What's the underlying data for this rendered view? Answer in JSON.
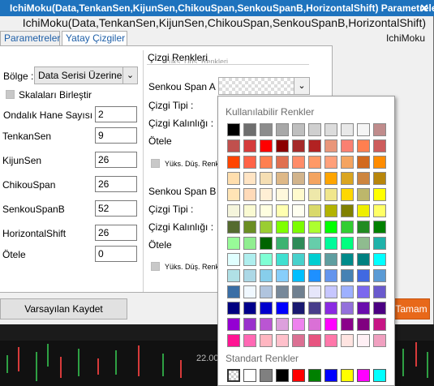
{
  "window": {
    "title": "IchiMoku(Data,TenkanSen,KijunSen,ChikouSpan,SenkouSpanB,HorizontalShift) Parametreleri",
    "subtitle": "IchiMoku(Data,TenkanSen,KijunSen,ChikouSpan,SenkouSpanB,HorizontalShift)",
    "chart_name": "IchiMoku",
    "close_glyph": "✕"
  },
  "tabs": [
    {
      "label": "Parametreler",
      "active": false
    },
    {
      "label": "Yatay Çizgiler",
      "active": true
    }
  ],
  "params": {
    "region_label": "Bölge :",
    "region_value": "Data Serisi Üzerine",
    "merge_scales_label": "Skalaları Birleştir",
    "decimal_label": "Ondalık Hane Sayısı :",
    "decimal_value": "2",
    "fields": [
      {
        "label": "TenkanSen",
        "value": "9"
      },
      {
        "label": "KijunSen",
        "value": "26"
      },
      {
        "label": "ChikouSpan",
        "value": "26"
      },
      {
        "label": "SenkouSpanB",
        "value": "52"
      },
      {
        "label": "HorizontalShift",
        "value": "26"
      },
      {
        "label": "Ötele",
        "value": "0"
      }
    ]
  },
  "line_colors": {
    "header": "Çizgi Renkleri",
    "hidden_label": "Yüks. Düş. Renkleri",
    "section_a": {
      "title": "Senkou Span A",
      "line_type": "Çizgi Tipi :",
      "line_width": "Çizgi Kalınlığı :",
      "shift": "Ötele",
      "hl_colors": "Yüks. Düş. Renkleri"
    },
    "section_b": {
      "title": "Senkou Span B",
      "line_type": "Çizgi Tipi :",
      "line_width": "Çizgi Kalınlığı :",
      "shift": "Ötele",
      "hl_colors": "Yüks. Düş. Renkleri"
    }
  },
  "buttons": {
    "save_default": "Varsayılan Kaydet",
    "ok": "Tamam"
  },
  "color_picker": {
    "available_title": "Kullanılabilir Renkler",
    "standard_title": "Standart Renkler",
    "available": [
      [
        "#000000",
        "#6e6e6e",
        "#8c8c8c",
        "#a8a8a8",
        "#bfbfbf",
        "#cfcfcf",
        "#dcdcdc",
        "#e8e8e8",
        "#f5f5f5",
        "#c08c8c"
      ],
      [
        "#c0504d",
        "#d43c3c",
        "#ff0000",
        "#8b0000",
        "#a52a2a",
        "#b22222",
        "#e9967a",
        "#fa8072",
        "#ff7f50",
        "#cd5c5c"
      ],
      [
        "#ff4500",
        "#ff6347",
        "#ff7f50",
        "#e07050",
        "#ff8c69",
        "#ff9966",
        "#ffa07a",
        "#f4a460",
        "#d2691e",
        "#ff8c00"
      ],
      [
        "#ffdead",
        "#ffe4c4",
        "#f5deb3",
        "#deb887",
        "#d2b48c",
        "#f4a460",
        "#ffa500",
        "#daa520",
        "#cd853f",
        "#b8860b"
      ],
      [
        "#ffe4b5",
        "#ffdab9",
        "#ffefd5",
        "#fff8dc",
        "#fffacd",
        "#eee8aa",
        "#f0e68c",
        "#ffd700",
        "#bdb76b",
        "#ffff00"
      ],
      [
        "#f5f5dc",
        "#fafad2",
        "#ffffe0",
        "#ffffb0",
        "#fffff0",
        "#d9d96a",
        "#b3b300",
        "#808000",
        "#eeee00",
        "#ffff66"
      ],
      [
        "#556b2f",
        "#6b8e23",
        "#9acd32",
        "#7fff00",
        "#7cfc00",
        "#adff2f",
        "#00ff00",
        "#32cd32",
        "#228b22",
        "#008000"
      ],
      [
        "#98fb98",
        "#90ee90",
        "#006400",
        "#3cb371",
        "#2e8b57",
        "#66cdaa",
        "#00fa9a",
        "#00ff7f",
        "#8fbc8f",
        "#20b2aa"
      ],
      [
        "#e0ffff",
        "#afeeee",
        "#7fffd4",
        "#40e0d0",
        "#48d1cc",
        "#00ced1",
        "#5f9ea0",
        "#008b8b",
        "#008080",
        "#00ffff"
      ],
      [
        "#b0e0e6",
        "#add8e6",
        "#87ceeb",
        "#87cefa",
        "#00bfff",
        "#1e90ff",
        "#6495ed",
        "#4682b4",
        "#4169e1",
        "#5b9bd5"
      ],
      [
        "#3a6ea5",
        "#f0f8ff",
        "#b0c4de",
        "#778899",
        "#708090",
        "#e6e6fa",
        "#c6c6ff",
        "#9db0ff",
        "#7b68ee",
        "#6a5acd"
      ],
      [
        "#000080",
        "#00008b",
        "#0000cd",
        "#0000ff",
        "#191970",
        "#483d8b",
        "#8a2be2",
        "#9370db",
        "#6a0dad",
        "#4b0082"
      ],
      [
        "#9400d3",
        "#9932cc",
        "#ba55d3",
        "#dda0dd",
        "#ee82ee",
        "#da70d6",
        "#ff00ff",
        "#8b008b",
        "#800080",
        "#c71585"
      ],
      [
        "#ff1493",
        "#ff69b4",
        "#ffb6c1",
        "#ffc0cb",
        "#db7093",
        "#e75480",
        "#ff77aa",
        "#ffe4e1",
        "#fff0f5",
        "#f0a0c0"
      ]
    ],
    "standard": [
      "#ffffff",
      "#ffffff",
      "#808080",
      "#000000",
      "#ff0000",
      "#008000",
      "#0000ff",
      "#ffff00",
      "#ff00ff",
      "#00ffff"
    ]
  },
  "background_chart": {
    "price_label": "22.00"
  }
}
